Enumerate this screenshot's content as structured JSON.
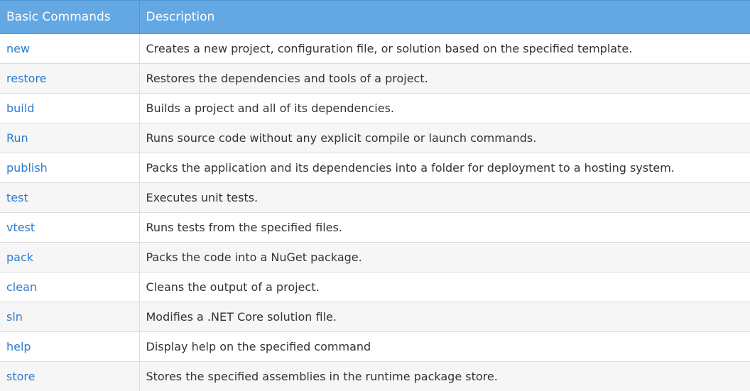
{
  "table": {
    "headers": [
      "Basic Commands",
      "Description"
    ],
    "rows": [
      {
        "command": "new",
        "description": "Creates a new project, configuration file, or solution based on the specified template."
      },
      {
        "command": "restore",
        "description": "Restores the dependencies and tools of a project."
      },
      {
        "command": "build",
        "description": "Builds a project and all of its dependencies."
      },
      {
        "command": "Run",
        "description": "Runs source code without any explicit compile or launch commands."
      },
      {
        "command": "publish",
        "description": "Packs the application and its dependencies into a folder for deployment to a hosting system."
      },
      {
        "command": "test",
        "description": "Executes unit tests."
      },
      {
        "command": "vtest",
        "description": "Runs tests from the specified files."
      },
      {
        "command": "pack",
        "description": "Packs the code into a NuGet package."
      },
      {
        "command": "clean",
        "description": "Cleans the output of a project."
      },
      {
        "command": "sln",
        "description": "Modifies a .NET Core solution file."
      },
      {
        "command": "help",
        "description": "Display help on the specified command"
      },
      {
        "command": "store",
        "description": "Stores the specified assemblies in the runtime package store."
      }
    ]
  },
  "colors": {
    "header_bg": "#64a8e3",
    "link": "#2b7bd2",
    "text": "#333333",
    "stripe": "#f6f6f6"
  }
}
